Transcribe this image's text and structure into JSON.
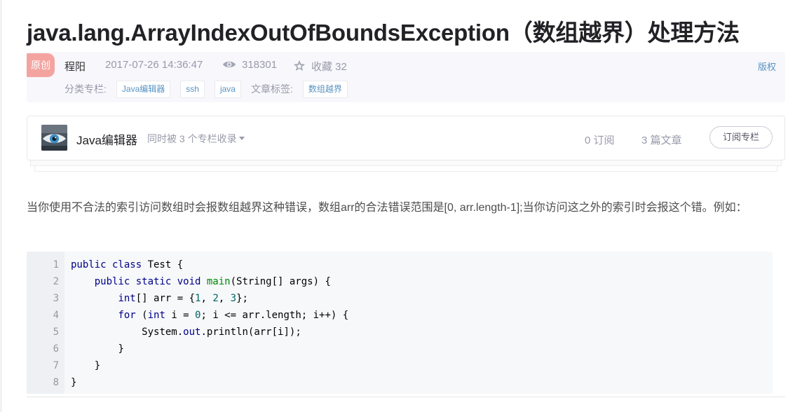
{
  "article": {
    "title": "java.lang.ArrayIndexOutOfBoundsException（数组越界）处理方法",
    "badge": "原创",
    "author": "程阳",
    "date": "2017-07-26 14:36:47",
    "views": "318301",
    "collect": "收藏 32",
    "copyright": "版权",
    "category_label": "分类专栏:",
    "categories": [
      "Java编辑器",
      "ssh",
      "java"
    ],
    "tag_label": "文章标签:",
    "tags": [
      "数组越界"
    ]
  },
  "column": {
    "name": "Java编辑器",
    "also_in": "同时被 3 个专栏收录",
    "subscribers": "0 订阅",
    "articles": "3 篇文章",
    "subscribe_button": "订阅专栏"
  },
  "content": {
    "paragraph": "当你使用不合法的索引访问数组时会报数组越界这种错误，数组arr的合法错误范围是[0, arr.length-1];当你访问这之外的索引时会报这个错。例如："
  },
  "code": {
    "line_numbers": [
      "1",
      "2",
      "3",
      "4",
      "5",
      "6",
      "7",
      "8"
    ],
    "lines": [
      {
        "indent": "",
        "tokens": [
          {
            "t": "public class ",
            "c": "kw"
          },
          {
            "t": "Test {",
            "c": "pl"
          }
        ]
      },
      {
        "indent": "    ",
        "tokens": [
          {
            "t": "public static void ",
            "c": "kw"
          },
          {
            "t": "main",
            "c": "fn"
          },
          {
            "t": "(String[] args) {",
            "c": "pl"
          }
        ]
      },
      {
        "indent": "        ",
        "tokens": [
          {
            "t": "int",
            "c": "kw"
          },
          {
            "t": "[] arr = {",
            "c": "pl"
          },
          {
            "t": "1",
            "c": "num"
          },
          {
            "t": ", ",
            "c": "pl"
          },
          {
            "t": "2",
            "c": "num"
          },
          {
            "t": ", ",
            "c": "pl"
          },
          {
            "t": "3",
            "c": "num"
          },
          {
            "t": "};",
            "c": "pl"
          }
        ]
      },
      {
        "indent": "        ",
        "tokens": [
          {
            "t": "for ",
            "c": "kw"
          },
          {
            "t": "(",
            "c": "pl"
          },
          {
            "t": "int ",
            "c": "kw"
          },
          {
            "t": "i = ",
            "c": "pl"
          },
          {
            "t": "0",
            "c": "num"
          },
          {
            "t": "; i <= arr.length; i++) {",
            "c": "pl"
          }
        ]
      },
      {
        "indent": "            ",
        "tokens": [
          {
            "t": "System.",
            "c": "pl"
          },
          {
            "t": "out",
            "c": "kw"
          },
          {
            "t": ".println(arr[i]);",
            "c": "pl"
          }
        ]
      },
      {
        "indent": "        ",
        "tokens": [
          {
            "t": "}",
            "c": "pl"
          }
        ]
      },
      {
        "indent": "    ",
        "tokens": [
          {
            "t": "}",
            "c": "pl"
          }
        ]
      },
      {
        "indent": "",
        "tokens": [
          {
            "t": "}",
            "c": "pl"
          }
        ]
      }
    ]
  },
  "colors": {
    "keyword": "#000088",
    "function": "#008800",
    "number": "#006666",
    "link": "#5893c2",
    "badge": "#f4a4a0"
  },
  "icons": {
    "views": "eye-icon",
    "collect": "star-icon",
    "dropdown": "caret-down-icon",
    "avatar": "column-avatar-eye-image"
  }
}
